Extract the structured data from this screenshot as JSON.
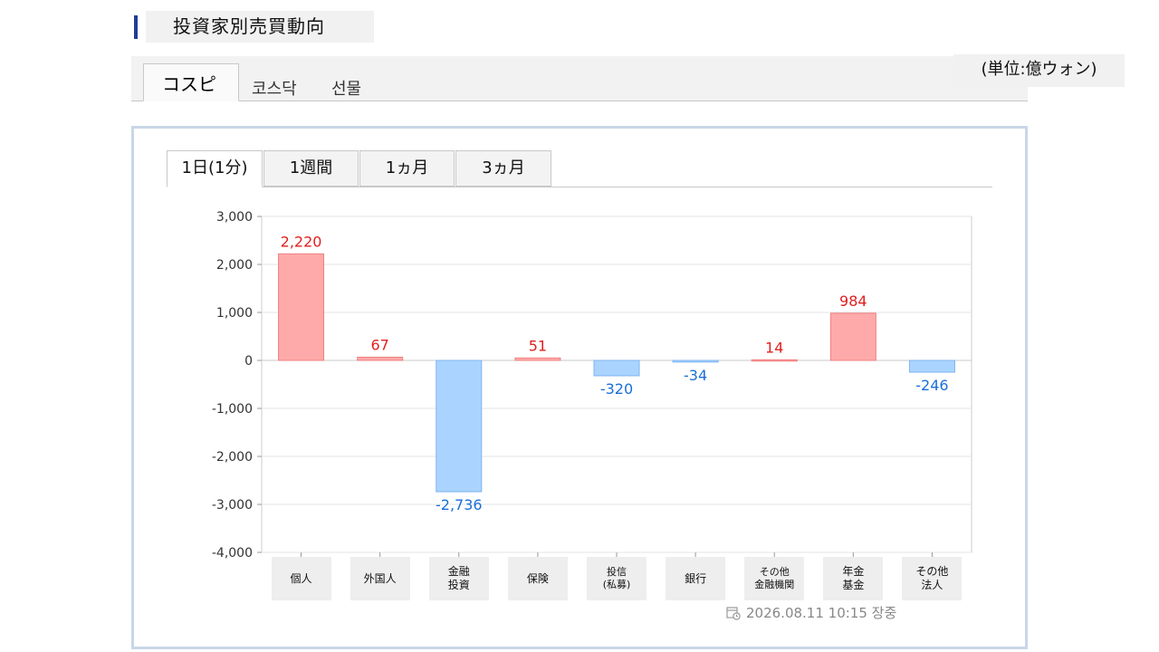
{
  "header": {
    "title": "投資家別売買動向"
  },
  "market_tabs": [
    {
      "label": "コスピ",
      "active": true
    },
    {
      "label": "코스닥",
      "active": false
    },
    {
      "label": "선물",
      "active": false
    }
  ],
  "unit_label": "(単位:億ウォン)",
  "period_tabs": [
    {
      "label": "1日(1分)",
      "active": true
    },
    {
      "label": "1週間",
      "active": false
    },
    {
      "label": "1ヵ月",
      "active": false
    },
    {
      "label": "3ヵ月",
      "active": false
    }
  ],
  "timestamp": "2026.08.11 10:15 장중",
  "colors": {
    "positive_fill": "#ffaaaa",
    "positive_stroke": "#f08080",
    "positive_text": "#e02020",
    "negative_fill": "#aad4ff",
    "negative_stroke": "#7fb4f0",
    "negative_text": "#1a6fd8",
    "accent": "#1f3c98"
  },
  "chart_data": {
    "type": "bar",
    "categories": [
      "個人",
      "外国人",
      "金融\n投資",
      "保険",
      "投信\n(私募)",
      "銀行",
      "その他\n金融機関",
      "年金\n基金",
      "その他\n法人"
    ],
    "values": [
      2220,
      67,
      -2736,
      51,
      -320,
      -34,
      14,
      984,
      -246
    ],
    "value_labels": [
      "2,220",
      "67",
      "-2,736",
      "51",
      "-320",
      "-34",
      "14",
      "984",
      "-246"
    ],
    "ylim": [
      -4000,
      3000
    ],
    "yticks": [
      3000,
      2000,
      1000,
      0,
      -1000,
      -2000,
      -3000,
      -4000
    ],
    "ytick_labels": [
      "3,000",
      "2,000",
      "1,000",
      "0",
      "-1,000",
      "-2,000",
      "-3,000",
      "-4,000"
    ],
    "grid": true
  }
}
